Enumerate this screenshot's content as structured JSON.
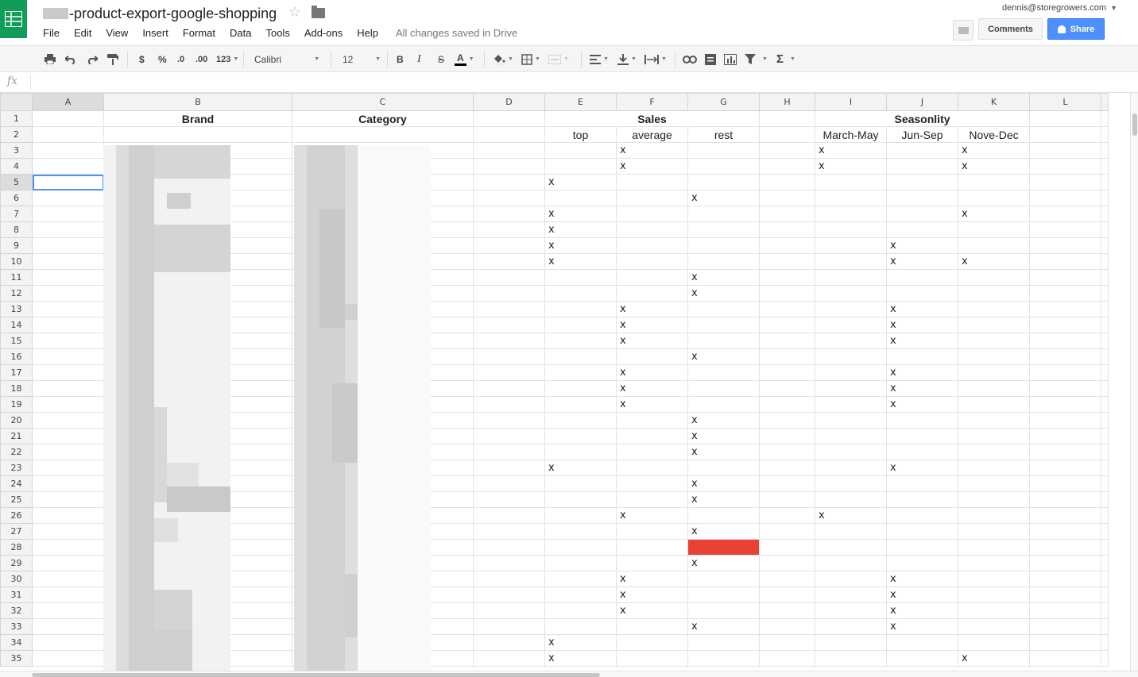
{
  "header": {
    "doc_title": "-product-export-google-shopping",
    "save_status": "All changes saved in Drive",
    "user_email": "dennis@storegrowers.com",
    "comments_label": "Comments",
    "share_label": "Share",
    "menu": [
      "File",
      "Edit",
      "View",
      "Insert",
      "Format",
      "Data",
      "Tools",
      "Add-ons",
      "Help"
    ]
  },
  "toolbar": {
    "currency": "$",
    "percent": "%",
    "dec_decrease": ".0",
    "dec_increase": ".00",
    "more_formats": "123",
    "font_name": "Calibri",
    "font_size": "12",
    "bold": "B",
    "italic": "I",
    "strike": "S",
    "text_color": "A",
    "functions": "Σ"
  },
  "formula_bar": {
    "fx_label": "fx",
    "value": ""
  },
  "sheet": {
    "columns": [
      "A",
      "B",
      "C",
      "D",
      "E",
      "F",
      "G",
      "H",
      "I",
      "J",
      "K",
      "L"
    ],
    "row1": {
      "brand": "Brand",
      "category": "Category",
      "sales": "Sales",
      "seasonality": "Seasonlity"
    },
    "row2": {
      "top": "top",
      "average": "average",
      "rest": "rest",
      "march_may": "March-May",
      "jun_sep": "Jun-Sep",
      "nov_dec": "Nove-Dec"
    },
    "mark_char": "x",
    "data_rows": [
      {
        "row": 3,
        "sales": "average",
        "season": [
          "I",
          "K"
        ]
      },
      {
        "row": 4,
        "sales": "average",
        "season": [
          "I",
          "K"
        ]
      },
      {
        "row": 5,
        "sales": "top",
        "season": []
      },
      {
        "row": 6,
        "sales": "rest",
        "season": []
      },
      {
        "row": 7,
        "sales": "top",
        "season": [
          "K"
        ]
      },
      {
        "row": 8,
        "sales": "top",
        "season": []
      },
      {
        "row": 9,
        "sales": "top",
        "season": [
          "J"
        ]
      },
      {
        "row": 10,
        "sales": "top",
        "season": [
          "J",
          "K"
        ]
      },
      {
        "row": 11,
        "sales": "rest",
        "season": []
      },
      {
        "row": 12,
        "sales": "rest",
        "season": []
      },
      {
        "row": 13,
        "sales": "average",
        "season": [
          "J"
        ]
      },
      {
        "row": 14,
        "sales": "average",
        "season": [
          "J"
        ]
      },
      {
        "row": 15,
        "sales": "average",
        "season": [
          "J"
        ]
      },
      {
        "row": 16,
        "sales": "rest",
        "season": []
      },
      {
        "row": 17,
        "sales": "average",
        "season": [
          "J"
        ]
      },
      {
        "row": 18,
        "sales": "average",
        "season": [
          "J"
        ]
      },
      {
        "row": 19,
        "sales": "average",
        "season": [
          "J"
        ]
      },
      {
        "row": 20,
        "sales": "rest",
        "season": []
      },
      {
        "row": 21,
        "sales": "rest",
        "season": []
      },
      {
        "row": 22,
        "sales": "rest",
        "season": []
      },
      {
        "row": 23,
        "sales": "top",
        "season": [
          "J"
        ]
      },
      {
        "row": 24,
        "sales": "rest",
        "season": []
      },
      {
        "row": 25,
        "sales": "rest",
        "season": []
      },
      {
        "row": 26,
        "sales": "average",
        "season": [
          "I"
        ]
      },
      {
        "row": 27,
        "sales": "rest",
        "season": []
      },
      {
        "row": 28,
        "sales": "",
        "season": [],
        "red_cell": "G"
      },
      {
        "row": 29,
        "sales": "rest",
        "season": []
      },
      {
        "row": 30,
        "sales": "average",
        "season": [
          "J"
        ]
      },
      {
        "row": 31,
        "sales": "average",
        "season": [
          "J"
        ]
      },
      {
        "row": 32,
        "sales": "average",
        "season": [
          "J"
        ]
      },
      {
        "row": 33,
        "sales": "rest",
        "season": [
          "J"
        ]
      },
      {
        "row": 34,
        "sales": "top",
        "season": []
      },
      {
        "row": 35,
        "sales": "top",
        "season": [
          "K"
        ]
      }
    ],
    "selected_cell": "A5",
    "red_fill_color": "#e94234",
    "selection_color": "#4d90fe"
  },
  "colors": {
    "sheets_green": "#0f9d58",
    "share_blue": "#4d90fe"
  }
}
